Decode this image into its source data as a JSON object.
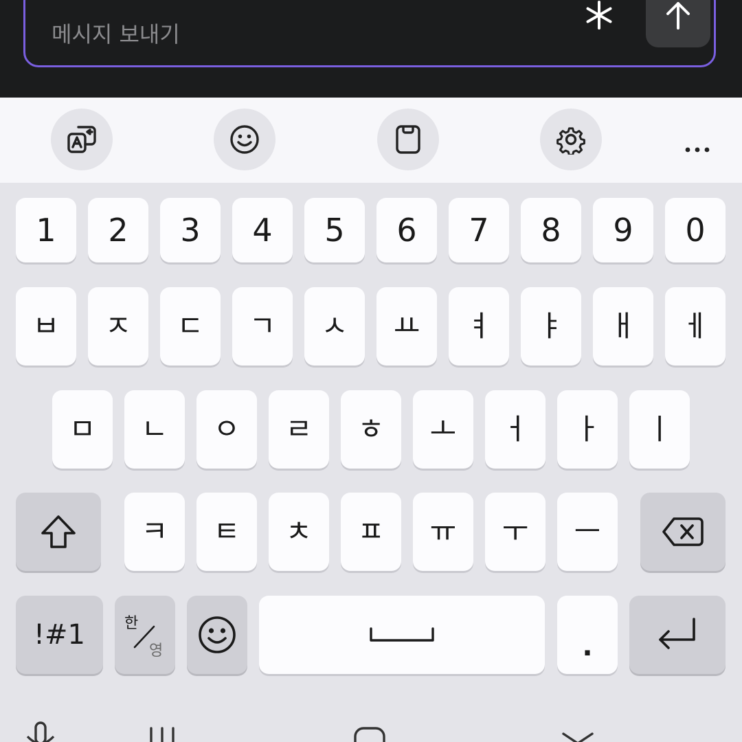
{
  "message_bar": {
    "placeholder": "메시지 보내기",
    "accent_color": "#7a5fe0",
    "icons": [
      "asterisk-icon",
      "arrow-up-icon"
    ]
  },
  "toolbar": {
    "icons": [
      "translate-icon",
      "emoji-icon",
      "clipboard-icon",
      "settings-icon",
      "more-icon"
    ]
  },
  "keyboard": {
    "number_row": [
      "1",
      "2",
      "3",
      "4",
      "5",
      "6",
      "7",
      "8",
      "9",
      "0"
    ],
    "row1": [
      "ㅂ",
      "ㅈ",
      "ㄷ",
      "ㄱ",
      "ㅅ",
      "ㅛ",
      "ㅕ",
      "ㅑ",
      "ㅐ",
      "ㅔ"
    ],
    "row2": [
      "ㅁ",
      "ㄴ",
      "ㅇ",
      "ㄹ",
      "ㅎ",
      "ㅗ",
      "ㅓ",
      "ㅏ",
      "ㅣ"
    ],
    "row3": [
      "ㅋ",
      "ㅌ",
      "ㅊ",
      "ㅍ",
      "ㅠ",
      "ㅜ",
      "ㅡ"
    ],
    "symbols_label": "!#1",
    "lang_han": "한",
    "lang_young": "영",
    "period": ".",
    "function_icons": [
      "shift-icon",
      "backspace-icon",
      "emoji-icon",
      "space-icon",
      "enter-icon"
    ]
  },
  "nav_icons": [
    "mic-icon",
    "recent-apps-icon",
    "home-icon",
    "back-icon"
  ]
}
